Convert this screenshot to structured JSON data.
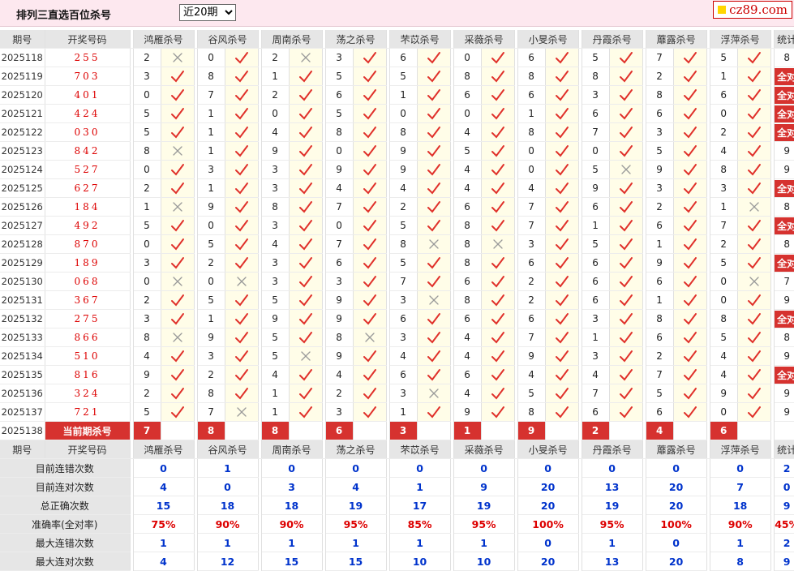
{
  "header": {
    "title": "排列三直选百位杀号",
    "period_selected": "近20期",
    "period_options": [
      "近20期"
    ],
    "logo_text": "cz89.com"
  },
  "columns": {
    "issue": "期号",
    "draw": "开奖号码",
    "experts": [
      "鸿雁杀号",
      "谷风杀号",
      "周南杀号",
      "荡之杀号",
      "芣苡杀号",
      "采薇杀号",
      "小旻杀号",
      "丹霞杀号",
      "蘼露杀号",
      "浮萍杀号"
    ],
    "stat": "统计"
  },
  "rows": [
    {
      "issue": "2025118",
      "draw": "255",
      "kills": [
        [
          2,
          0
        ],
        [
          0,
          1
        ],
        [
          2,
          0
        ],
        [
          3,
          1
        ],
        [
          6,
          1
        ],
        [
          0,
          1
        ],
        [
          6,
          1
        ],
        [
          5,
          1
        ],
        [
          7,
          1
        ],
        [
          5,
          1
        ]
      ],
      "stat": "8"
    },
    {
      "issue": "2025119",
      "draw": "703",
      "kills": [
        [
          3,
          1
        ],
        [
          8,
          1
        ],
        [
          1,
          1
        ],
        [
          5,
          1
        ],
        [
          5,
          1
        ],
        [
          8,
          1
        ],
        [
          8,
          1
        ],
        [
          8,
          1
        ],
        [
          2,
          1
        ],
        [
          1,
          1
        ]
      ],
      "stat": "全对"
    },
    {
      "issue": "2025120",
      "draw": "401",
      "kills": [
        [
          0,
          1
        ],
        [
          7,
          1
        ],
        [
          2,
          1
        ],
        [
          6,
          1
        ],
        [
          1,
          1
        ],
        [
          6,
          1
        ],
        [
          6,
          1
        ],
        [
          3,
          1
        ],
        [
          8,
          1
        ],
        [
          6,
          1
        ]
      ],
      "stat": "全对"
    },
    {
      "issue": "2025121",
      "draw": "424",
      "kills": [
        [
          5,
          1
        ],
        [
          1,
          1
        ],
        [
          0,
          1
        ],
        [
          5,
          1
        ],
        [
          0,
          1
        ],
        [
          0,
          1
        ],
        [
          1,
          1
        ],
        [
          6,
          1
        ],
        [
          6,
          1
        ],
        [
          0,
          1
        ]
      ],
      "stat": "全对"
    },
    {
      "issue": "2025122",
      "draw": "030",
      "kills": [
        [
          5,
          1
        ],
        [
          1,
          1
        ],
        [
          4,
          1
        ],
        [
          8,
          1
        ],
        [
          8,
          1
        ],
        [
          4,
          1
        ],
        [
          8,
          1
        ],
        [
          7,
          1
        ],
        [
          3,
          1
        ],
        [
          2,
          1
        ]
      ],
      "stat": "全对"
    },
    {
      "issue": "2025123",
      "draw": "842",
      "kills": [
        [
          8,
          0
        ],
        [
          1,
          1
        ],
        [
          9,
          1
        ],
        [
          0,
          1
        ],
        [
          9,
          1
        ],
        [
          5,
          1
        ],
        [
          0,
          1
        ],
        [
          0,
          1
        ],
        [
          5,
          1
        ],
        [
          4,
          1
        ]
      ],
      "stat": "9"
    },
    {
      "issue": "2025124",
      "draw": "527",
      "kills": [
        [
          0,
          1
        ],
        [
          3,
          1
        ],
        [
          3,
          1
        ],
        [
          9,
          1
        ],
        [
          9,
          1
        ],
        [
          4,
          1
        ],
        [
          0,
          1
        ],
        [
          5,
          0
        ],
        [
          9,
          1
        ],
        [
          8,
          1
        ]
      ],
      "stat": "9"
    },
    {
      "issue": "2025125",
      "draw": "627",
      "kills": [
        [
          2,
          1
        ],
        [
          1,
          1
        ],
        [
          3,
          1
        ],
        [
          4,
          1
        ],
        [
          4,
          1
        ],
        [
          4,
          1
        ],
        [
          4,
          1
        ],
        [
          9,
          1
        ],
        [
          3,
          1
        ],
        [
          3,
          1
        ]
      ],
      "stat": "全对"
    },
    {
      "issue": "2025126",
      "draw": "184",
      "kills": [
        [
          1,
          0
        ],
        [
          9,
          1
        ],
        [
          8,
          1
        ],
        [
          7,
          1
        ],
        [
          2,
          1
        ],
        [
          6,
          1
        ],
        [
          7,
          1
        ],
        [
          6,
          1
        ],
        [
          2,
          1
        ],
        [
          1,
          0
        ]
      ],
      "stat": "8"
    },
    {
      "issue": "2025127",
      "draw": "492",
      "kills": [
        [
          5,
          1
        ],
        [
          0,
          1
        ],
        [
          3,
          1
        ],
        [
          0,
          1
        ],
        [
          5,
          1
        ],
        [
          8,
          1
        ],
        [
          7,
          1
        ],
        [
          1,
          1
        ],
        [
          6,
          1
        ],
        [
          7,
          1
        ]
      ],
      "stat": "全对"
    },
    {
      "issue": "2025128",
      "draw": "870",
      "kills": [
        [
          0,
          1
        ],
        [
          5,
          1
        ],
        [
          4,
          1
        ],
        [
          7,
          1
        ],
        [
          8,
          0
        ],
        [
          8,
          0
        ],
        [
          3,
          1
        ],
        [
          5,
          1
        ],
        [
          1,
          1
        ],
        [
          2,
          1
        ]
      ],
      "stat": "8"
    },
    {
      "issue": "2025129",
      "draw": "189",
      "kills": [
        [
          3,
          1
        ],
        [
          2,
          1
        ],
        [
          3,
          1
        ],
        [
          6,
          1
        ],
        [
          5,
          1
        ],
        [
          8,
          1
        ],
        [
          6,
          1
        ],
        [
          6,
          1
        ],
        [
          9,
          1
        ],
        [
          5,
          1
        ]
      ],
      "stat": "全对"
    },
    {
      "issue": "2025130",
      "draw": "068",
      "kills": [
        [
          0,
          0
        ],
        [
          0,
          0
        ],
        [
          3,
          1
        ],
        [
          3,
          1
        ],
        [
          7,
          1
        ],
        [
          6,
          1
        ],
        [
          2,
          1
        ],
        [
          6,
          1
        ],
        [
          6,
          1
        ],
        [
          0,
          0
        ]
      ],
      "stat": "7"
    },
    {
      "issue": "2025131",
      "draw": "367",
      "kills": [
        [
          2,
          1
        ],
        [
          5,
          1
        ],
        [
          5,
          1
        ],
        [
          9,
          1
        ],
        [
          3,
          0
        ],
        [
          8,
          1
        ],
        [
          2,
          1
        ],
        [
          6,
          1
        ],
        [
          1,
          1
        ],
        [
          0,
          1
        ]
      ],
      "stat": "9"
    },
    {
      "issue": "2025132",
      "draw": "275",
      "kills": [
        [
          3,
          1
        ],
        [
          1,
          1
        ],
        [
          9,
          1
        ],
        [
          9,
          1
        ],
        [
          6,
          1
        ],
        [
          6,
          1
        ],
        [
          6,
          1
        ],
        [
          3,
          1
        ],
        [
          8,
          1
        ],
        [
          8,
          1
        ]
      ],
      "stat": "全对"
    },
    {
      "issue": "2025133",
      "draw": "866",
      "kills": [
        [
          8,
          0
        ],
        [
          9,
          1
        ],
        [
          5,
          1
        ],
        [
          8,
          0
        ],
        [
          3,
          1
        ],
        [
          4,
          1
        ],
        [
          7,
          1
        ],
        [
          1,
          1
        ],
        [
          6,
          1
        ],
        [
          5,
          1
        ]
      ],
      "stat": "8"
    },
    {
      "issue": "2025134",
      "draw": "510",
      "kills": [
        [
          4,
          1
        ],
        [
          3,
          1
        ],
        [
          5,
          0
        ],
        [
          9,
          1
        ],
        [
          4,
          1
        ],
        [
          4,
          1
        ],
        [
          9,
          1
        ],
        [
          3,
          1
        ],
        [
          2,
          1
        ],
        [
          4,
          1
        ]
      ],
      "stat": "9"
    },
    {
      "issue": "2025135",
      "draw": "816",
      "kills": [
        [
          9,
          1
        ],
        [
          2,
          1
        ],
        [
          4,
          1
        ],
        [
          4,
          1
        ],
        [
          6,
          1
        ],
        [
          6,
          1
        ],
        [
          4,
          1
        ],
        [
          4,
          1
        ],
        [
          7,
          1
        ],
        [
          4,
          1
        ]
      ],
      "stat": "全对"
    },
    {
      "issue": "2025136",
      "draw": "324",
      "kills": [
        [
          2,
          1
        ],
        [
          8,
          1
        ],
        [
          1,
          1
        ],
        [
          2,
          1
        ],
        [
          3,
          0
        ],
        [
          4,
          1
        ],
        [
          5,
          1
        ],
        [
          7,
          1
        ],
        [
          5,
          1
        ],
        [
          9,
          1
        ]
      ],
      "stat": "9"
    },
    {
      "issue": "2025137",
      "draw": "721",
      "kills": [
        [
          5,
          1
        ],
        [
          7,
          0
        ],
        [
          1,
          1
        ],
        [
          3,
          1
        ],
        [
          1,
          1
        ],
        [
          9,
          1
        ],
        [
          8,
          1
        ],
        [
          6,
          1
        ],
        [
          6,
          1
        ],
        [
          0,
          1
        ]
      ],
      "stat": "9"
    }
  ],
  "current": {
    "issue": "2025138",
    "label": "当前期杀号",
    "kills": [
      "7",
      "8",
      "8",
      "6",
      "3",
      "1",
      "9",
      "2",
      "4",
      "6"
    ]
  },
  "stats": [
    {
      "label": "目前连错次数",
      "values": [
        "0",
        "1",
        "0",
        "0",
        "0",
        "0",
        "0",
        "0",
        "0",
        "0"
      ],
      "total": "2",
      "color": "blue"
    },
    {
      "label": "目前连对次数",
      "values": [
        "4",
        "0",
        "3",
        "4",
        "1",
        "9",
        "20",
        "13",
        "20",
        "7"
      ],
      "total": "0",
      "color": "blue"
    },
    {
      "label": "总正确次数",
      "values": [
        "15",
        "18",
        "18",
        "19",
        "17",
        "19",
        "20",
        "19",
        "20",
        "18"
      ],
      "total": "9",
      "color": "blue"
    },
    {
      "label": "准确率(全对率)",
      "values": [
        "75%",
        "90%",
        "90%",
        "95%",
        "85%",
        "95%",
        "100%",
        "95%",
        "100%",
        "90%"
      ],
      "total": "45%",
      "color": "red"
    },
    {
      "label": "最大连错次数",
      "values": [
        "1",
        "1",
        "1",
        "1",
        "1",
        "1",
        "0",
        "1",
        "0",
        "1"
      ],
      "total": "2",
      "color": "blue"
    },
    {
      "label": "最大连对次数",
      "values": [
        "4",
        "12",
        "15",
        "15",
        "10",
        "10",
        "20",
        "13",
        "20",
        "8"
      ],
      "total": "9",
      "color": "blue"
    }
  ]
}
